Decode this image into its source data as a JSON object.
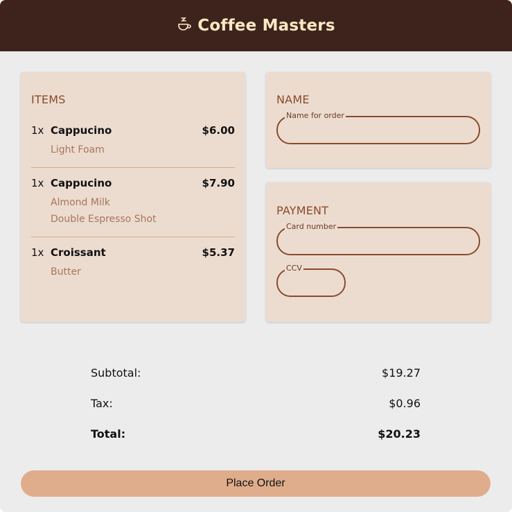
{
  "header": {
    "title": "Coffee Masters",
    "logo_icon": "coffee-cup-icon",
    "background": "#3e231c",
    "title_color": "#fbe9c4"
  },
  "items_card": {
    "title": "ITEMS",
    "items": [
      {
        "qty": "1x",
        "name": "Cappucino",
        "price": "$6.00",
        "options": [
          "Light Foam"
        ]
      },
      {
        "qty": "1x",
        "name": "Cappucino",
        "price": "$7.90",
        "options": [
          "Almond Milk",
          "Double Espresso Shot"
        ]
      },
      {
        "qty": "1x",
        "name": "Croissant",
        "price": "$5.37",
        "options": [
          "Butter"
        ]
      }
    ]
  },
  "name_card": {
    "title": "NAME",
    "name_field": {
      "label": "Name for order",
      "value": ""
    }
  },
  "payment_card": {
    "title": "PAYMENT",
    "card_field": {
      "label": "Card number",
      "value": ""
    },
    "ccv_field": {
      "label": "CCV",
      "value": ""
    }
  },
  "totals": {
    "subtotal_label": "Subtotal:",
    "subtotal_value": "$19.27",
    "tax_label": "Tax:",
    "tax_value": "$0.96",
    "total_label": "Total:",
    "total_value": "$20.23"
  },
  "actions": {
    "place_order_label": "Place Order",
    "button_color": "#dfad8b"
  },
  "colors": {
    "page_background": "#ececec",
    "card_background": "#ecdcd0",
    "accent_brown": "#8a4a2b",
    "option_text": "#a8755a"
  }
}
